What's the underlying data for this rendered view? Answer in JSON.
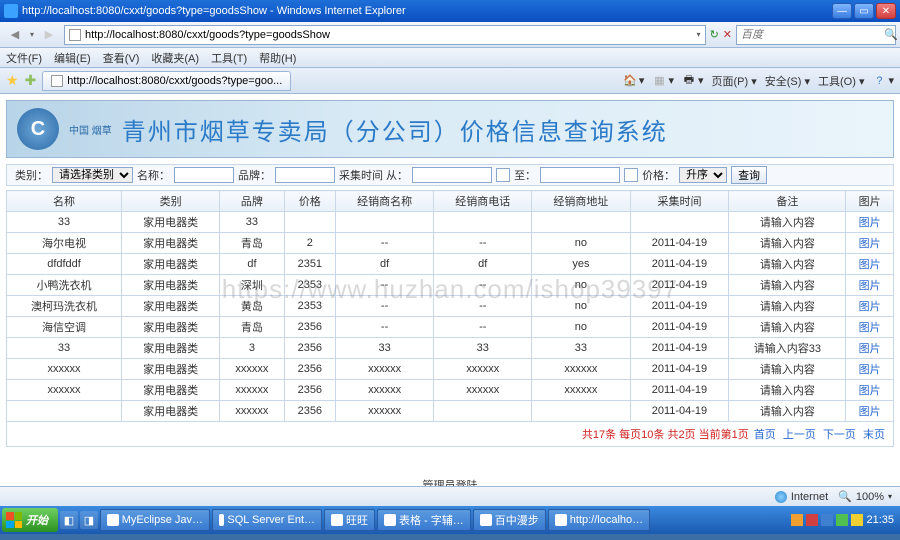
{
  "window": {
    "title": "http://localhost:8080/cxxt/goods?type=goodsShow - Windows Internet Explorer"
  },
  "nav": {
    "url": "http://localhost:8080/cxxt/goods?type=goodsShow",
    "search_placeholder": "百度",
    "refresh": "↻",
    "stop": "✕"
  },
  "menu": {
    "file": "文件(F)",
    "edit": "编辑(E)",
    "view": "查看(V)",
    "favorites": "收藏夹(A)",
    "tools": "工具(T)",
    "help": "帮助(H)"
  },
  "tab": {
    "label": "http://localhost:8080/cxxt/goods?type=goo..."
  },
  "ietools": {
    "home": "▾",
    "feeds": "▾",
    "print": "▾",
    "page": "页面(P) ▾",
    "safety": "安全(S) ▾",
    "tools": "工具(O) ▾"
  },
  "banner": {
    "logo_sub": "中国 烟草",
    "title": "青州市烟草专卖局（分公司）价格信息查询系统"
  },
  "filter": {
    "type_label": "类别：",
    "type_value": "请选择类别",
    "name_label": "名称：",
    "brand_label": "品牌：",
    "date_label": "采集时间 从：",
    "to": "至：",
    "price_label": "价格：",
    "sort_value": "升序",
    "btn": "查询"
  },
  "columns": [
    "名称",
    "类别",
    "品牌",
    "价格",
    "经销商名称",
    "经销商电话",
    "经销商地址",
    "采集时间",
    "备注",
    "图片"
  ],
  "rows": [
    {
      "name": "33",
      "cat": "家用电器类",
      "brand": "33",
      "price": "",
      "dealer": "",
      "tel": "",
      "addr": "",
      "date": "",
      "note": "请输入内容",
      "pic": "图片"
    },
    {
      "name": "海尔电视",
      "cat": "家用电器类",
      "brand": "青岛",
      "price": "2",
      "dealer": "--",
      "tel": "--",
      "addr": "no",
      "date": "2011-04-19",
      "note": "请输入内容",
      "pic": "图片"
    },
    {
      "name": "dfdfddf",
      "cat": "家用电器类",
      "brand": "df",
      "price": "2351",
      "dealer": "df",
      "tel": "df",
      "addr": "yes",
      "date": "2011-04-19",
      "note": "请输入内容",
      "pic": "图片"
    },
    {
      "name": "小鸭洗衣机",
      "cat": "家用电器类",
      "brand": "深圳",
      "price": "2353",
      "dealer": "--",
      "tel": "--",
      "addr": "no",
      "date": "2011-04-19",
      "note": "请输入内容",
      "pic": "图片"
    },
    {
      "name": "澳柯玛洗衣机",
      "cat": "家用电器类",
      "brand": "黄岛",
      "price": "2353",
      "dealer": "--",
      "tel": "--",
      "addr": "no",
      "date": "2011-04-19",
      "note": "请输入内容",
      "pic": "图片"
    },
    {
      "name": "海信空调",
      "cat": "家用电器类",
      "brand": "青岛",
      "price": "2356",
      "dealer": "--",
      "tel": "--",
      "addr": "no",
      "date": "2011-04-19",
      "note": "请输入内容",
      "pic": "图片"
    },
    {
      "name": "33",
      "cat": "家用电器类",
      "brand": "3",
      "price": "2356",
      "dealer": "33",
      "tel": "33",
      "addr": "33",
      "date": "2011-04-19",
      "note": "请输入内容33",
      "pic": "图片"
    },
    {
      "name": "xxxxxx",
      "cat": "家用电器类",
      "brand": "xxxxxx",
      "price": "2356",
      "dealer": "xxxxxx",
      "tel": "xxxxxx",
      "addr": "xxxxxx",
      "date": "2011-04-19",
      "note": "请输入内容",
      "pic": "图片"
    },
    {
      "name": "xxxxxx",
      "cat": "家用电器类",
      "brand": "xxxxxx",
      "price": "2356",
      "dealer": "xxxxxx",
      "tel": "xxxxxx",
      "addr": "xxxxxx",
      "date": "2011-04-19",
      "note": "请输入内容",
      "pic": "图片"
    },
    {
      "name": "",
      "cat": "家用电器类",
      "brand": "xxxxxx",
      "price": "2356",
      "dealer": "xxxxxx",
      "tel": "",
      "addr": "",
      "date": "2011-04-19",
      "note": "请输入内容",
      "pic": "图片"
    }
  ],
  "pager": {
    "summary1": "共17条 每页10条 共2页 ",
    "current": "当前第1页",
    "first": "首页",
    "prev": "上一页",
    "next": "下一页",
    "last": "末页"
  },
  "admin_login": "管理员登陆",
  "watermark": "https://www.huzhan.com/ishop39397",
  "status": {
    "zone": "Internet",
    "zoom": "100%"
  },
  "taskbar": {
    "start": "开始",
    "items": [
      "MyEclipse Jav…",
      "SQL Server Ent…",
      "旺旺",
      "表格 - 字辅…",
      "百中漫步",
      "http://localho…"
    ],
    "clock": "21:35"
  }
}
